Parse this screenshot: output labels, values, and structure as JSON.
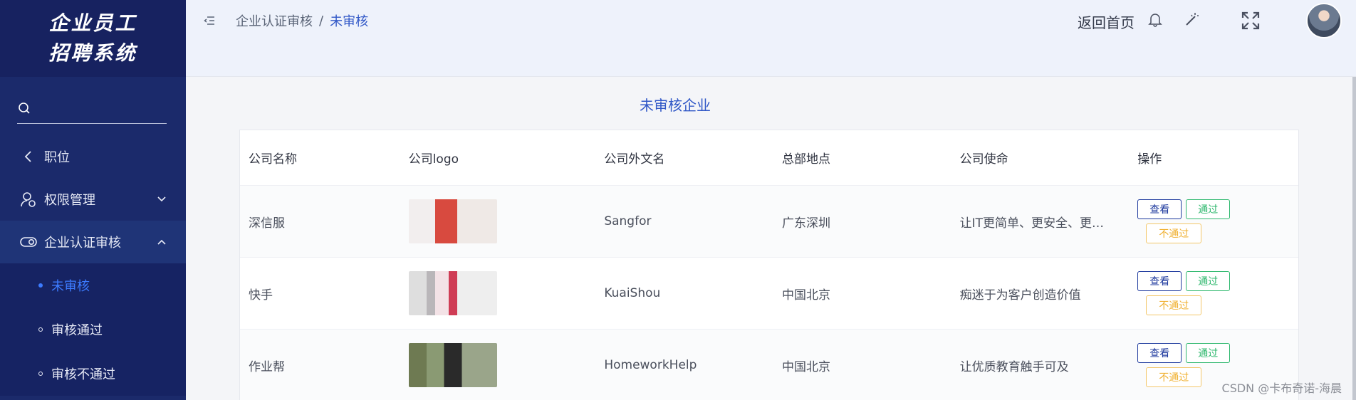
{
  "brand": {
    "line1": "企业员工",
    "line2": "招聘系统"
  },
  "search": {
    "placeholder": ""
  },
  "sidebar": {
    "items": [
      {
        "label": "职位",
        "icon": "chevron-left-icon"
      },
      {
        "label": "权限管理",
        "icon": "user-settings-icon"
      },
      {
        "label": "企业认证审核",
        "icon": "toggle-icon"
      }
    ],
    "sub": [
      {
        "label": "未审核",
        "active": true
      },
      {
        "label": "审核通过",
        "active": false
      },
      {
        "label": "审核不通过",
        "active": false
      }
    ]
  },
  "header": {
    "breadcrumb_parent": "企业认证审核",
    "breadcrumb_sep": "/",
    "breadcrumb_current": "未审核",
    "home_link": "返回首页"
  },
  "page": {
    "title": "未审核企业"
  },
  "table": {
    "headers": [
      "公司名称",
      "公司logo",
      "公司外文名",
      "总部地点",
      "公司使命",
      "操作"
    ],
    "rows": [
      {
        "name": "深信服",
        "foreign": "Sangfor",
        "hq": "广东深圳",
        "mission": "让IT更简单、更安全、更…"
      },
      {
        "name": "快手",
        "foreign": "KuaiShou",
        "hq": "中国北京",
        "mission": "痴迷于为客户创造价值"
      },
      {
        "name": "作业帮",
        "foreign": "HomeworkHelp",
        "hq": "中国北京",
        "mission": "让优质教育触手可及"
      }
    ],
    "actions": {
      "view": "查看",
      "pass": "通过",
      "fail": "不通过"
    }
  },
  "watermark": "CSDN @卡布奇诺-海晨",
  "colors": {
    "sidebar": "#1b2a6b",
    "accent": "#3158c7",
    "pass": "#2fb86e",
    "fail": "#f0b030"
  }
}
